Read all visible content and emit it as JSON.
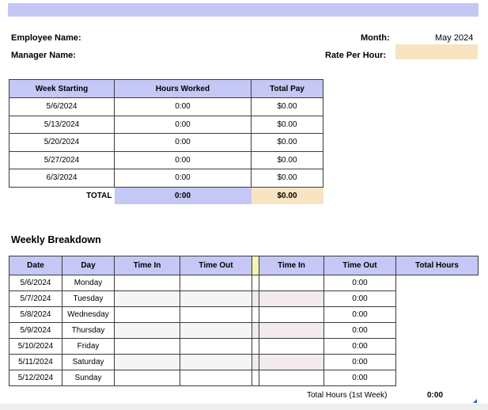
{
  "header": {
    "employee_label": "Employee Name:",
    "manager_label": "Manager Name:",
    "month_label": "Month:",
    "month_value": "May 2024",
    "rate_label": "Rate Per Hour:"
  },
  "summary": {
    "columns": [
      "Week Starting",
      "Hours Worked",
      "Total Pay"
    ],
    "rows": [
      {
        "week": "5/6/2024",
        "hours": "0:00",
        "pay": "$0.00"
      },
      {
        "week": "5/13/2024",
        "hours": "0:00",
        "pay": "$0.00"
      },
      {
        "week": "5/20/2024",
        "hours": "0:00",
        "pay": "$0.00"
      },
      {
        "week": "5/27/2024",
        "hours": "0:00",
        "pay": "$0.00"
      },
      {
        "week": "6/3/2024",
        "hours": "0:00",
        "pay": "$0.00"
      }
    ],
    "total_label": "TOTAL",
    "total_hours": "0:00",
    "total_pay": "$0.00"
  },
  "weekly": {
    "title": "Weekly Breakdown",
    "columns": [
      "Date",
      "Day",
      "Time In",
      "Time Out",
      "Time In",
      "Time Out",
      "Total Hours"
    ],
    "rows": [
      {
        "date": "5/6/2024",
        "day": "Monday",
        "total": "0:00"
      },
      {
        "date": "5/7/2024",
        "day": "Tuesday",
        "total": "0:00"
      },
      {
        "date": "5/8/2024",
        "day": "Wednesday",
        "total": "0:00"
      },
      {
        "date": "5/9/2024",
        "day": "Thursday",
        "total": "0:00"
      },
      {
        "date": "5/10/2024",
        "day": "Friday",
        "total": "0:00"
      },
      {
        "date": "5/11/2024",
        "day": "Saturday",
        "total": "0:00"
      },
      {
        "date": "5/12/2024",
        "day": "Sunday",
        "total": "0:00"
      }
    ],
    "footer_label": "Total Hours (1st Week)",
    "footer_value": "0:00"
  },
  "colors": {
    "header_fill": "#c5c7f5",
    "pay_fill": "#f8e4c3",
    "separator_fill": "#f5f5b0"
  },
  "icons": {
    "corner": "resize-corner-icon"
  }
}
